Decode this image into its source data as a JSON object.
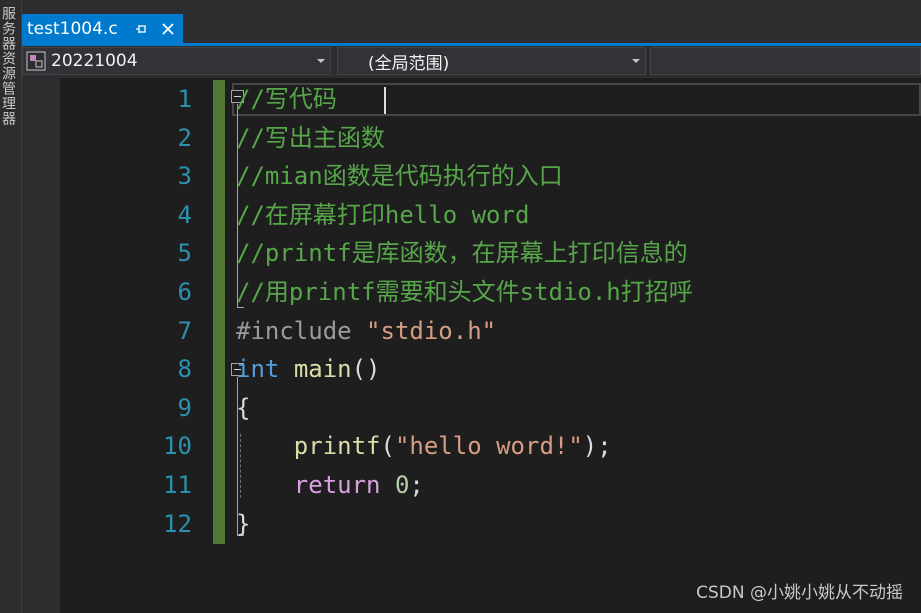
{
  "sidebar": {
    "label": "服务器资源管理器"
  },
  "tab": {
    "title": "test1004.c",
    "pin_icon": "pin-icon",
    "close_icon": "close-icon",
    "accent": "#007acc"
  },
  "nav": {
    "project": "20221004",
    "scope": "(全局范围)",
    "member": ""
  },
  "editor": {
    "line_numbers": [
      "1",
      "2",
      "3",
      "4",
      "5",
      "6",
      "7",
      "8",
      "9",
      "10",
      "11",
      "12"
    ],
    "lines": [
      [
        {
          "t": "//写代码",
          "c": "cmt"
        }
      ],
      [
        {
          "t": "//写出主函数",
          "c": "cmt"
        }
      ],
      [
        {
          "t": "//mian函数是代码执行的入口",
          "c": "cmt"
        }
      ],
      [
        {
          "t": "//在屏幕打印hello word",
          "c": "cmt"
        }
      ],
      [
        {
          "t": "//printf是库函数，在屏幕上打印信息的",
          "c": "cmt"
        }
      ],
      [
        {
          "t": "//用printf需要和头文件stdio.h打招呼",
          "c": "cmt"
        }
      ],
      [
        {
          "t": "#include ",
          "c": "pre"
        },
        {
          "t": "\"stdio.h\"",
          "c": "str"
        }
      ],
      [
        {
          "t": "int",
          "c": "kw"
        },
        {
          "t": " ",
          "c": "pun"
        },
        {
          "t": "main",
          "c": "fn"
        },
        {
          "t": "()",
          "c": "pun"
        }
      ],
      [
        {
          "t": "{",
          "c": "pun"
        }
      ],
      [
        {
          "t": "    ",
          "c": "pun"
        },
        {
          "t": "printf",
          "c": "fn"
        },
        {
          "t": "(",
          "c": "pun"
        },
        {
          "t": "\"hello word!\"",
          "c": "str"
        },
        {
          "t": ");",
          "c": "pun"
        }
      ],
      [
        {
          "t": "    ",
          "c": "pun"
        },
        {
          "t": "return",
          "c": "ctl"
        },
        {
          "t": " ",
          "c": "pun"
        },
        {
          "t": "0",
          "c": "num"
        },
        {
          "t": ";",
          "c": "pun"
        }
      ],
      [
        {
          "t": "}",
          "c": "pun"
        }
      ]
    ]
  },
  "watermark": "CSDN @小姚小姚从不动摇"
}
